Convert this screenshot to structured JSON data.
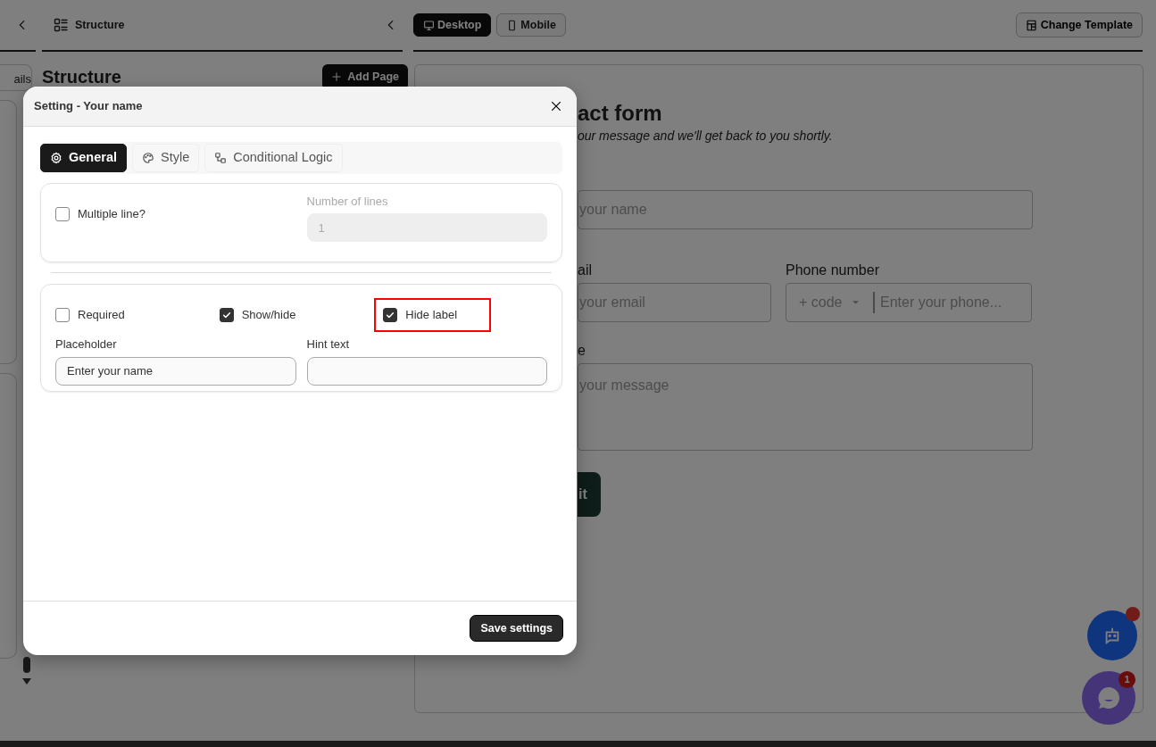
{
  "left_rail": {
    "tab": "ails"
  },
  "toolbar": {
    "panel_title": "Structure",
    "view_buttons": [
      {
        "label": "Desktop",
        "kind": "desktop",
        "selected": true
      },
      {
        "label": "Mobile",
        "kind": "mobile",
        "selected": false
      }
    ],
    "change_template": "Change Template"
  },
  "structure": {
    "heading": "Structure",
    "add_button": "Add Page"
  },
  "preview": {
    "title": "act form",
    "subtitle": "our message and we'll get back to you shortly.",
    "name_field": {
      "placeholder": "your name"
    },
    "email_field": {
      "label": "ail",
      "placeholder": "your email"
    },
    "phone_field": {
      "label": "Phone number",
      "code": "+ code",
      "placeholder": "Enter your phone..."
    },
    "message_field": {
      "label": "e",
      "placeholder": "your message"
    },
    "submit": "it"
  },
  "modal": {
    "title": "Setting - Your name",
    "tabs": [
      {
        "label": "General",
        "kind": "gear",
        "selected": true
      },
      {
        "label": "Style",
        "kind": "palette",
        "selected": false
      },
      {
        "label": "Conditional Logic",
        "kind": "logic",
        "selected": false
      }
    ],
    "multiple_line": {
      "label": "Multiple line?",
      "checked": false
    },
    "number_of_lines": {
      "label": "Number of lines",
      "value": "1",
      "disabled": true
    },
    "options": [
      {
        "label": "Required",
        "checked": false,
        "highlighted": false
      },
      {
        "label": "Show/hide",
        "checked": true,
        "highlighted": false
      },
      {
        "label": "Hide label",
        "checked": true,
        "highlighted": true
      }
    ],
    "placeholder_field": {
      "label": "Placeholder",
      "value": "Enter your name"
    },
    "hint_field": {
      "label": "Hint text"
    },
    "save_button": "Save settings"
  },
  "chat_launcher": {
    "badge": "1"
  }
}
